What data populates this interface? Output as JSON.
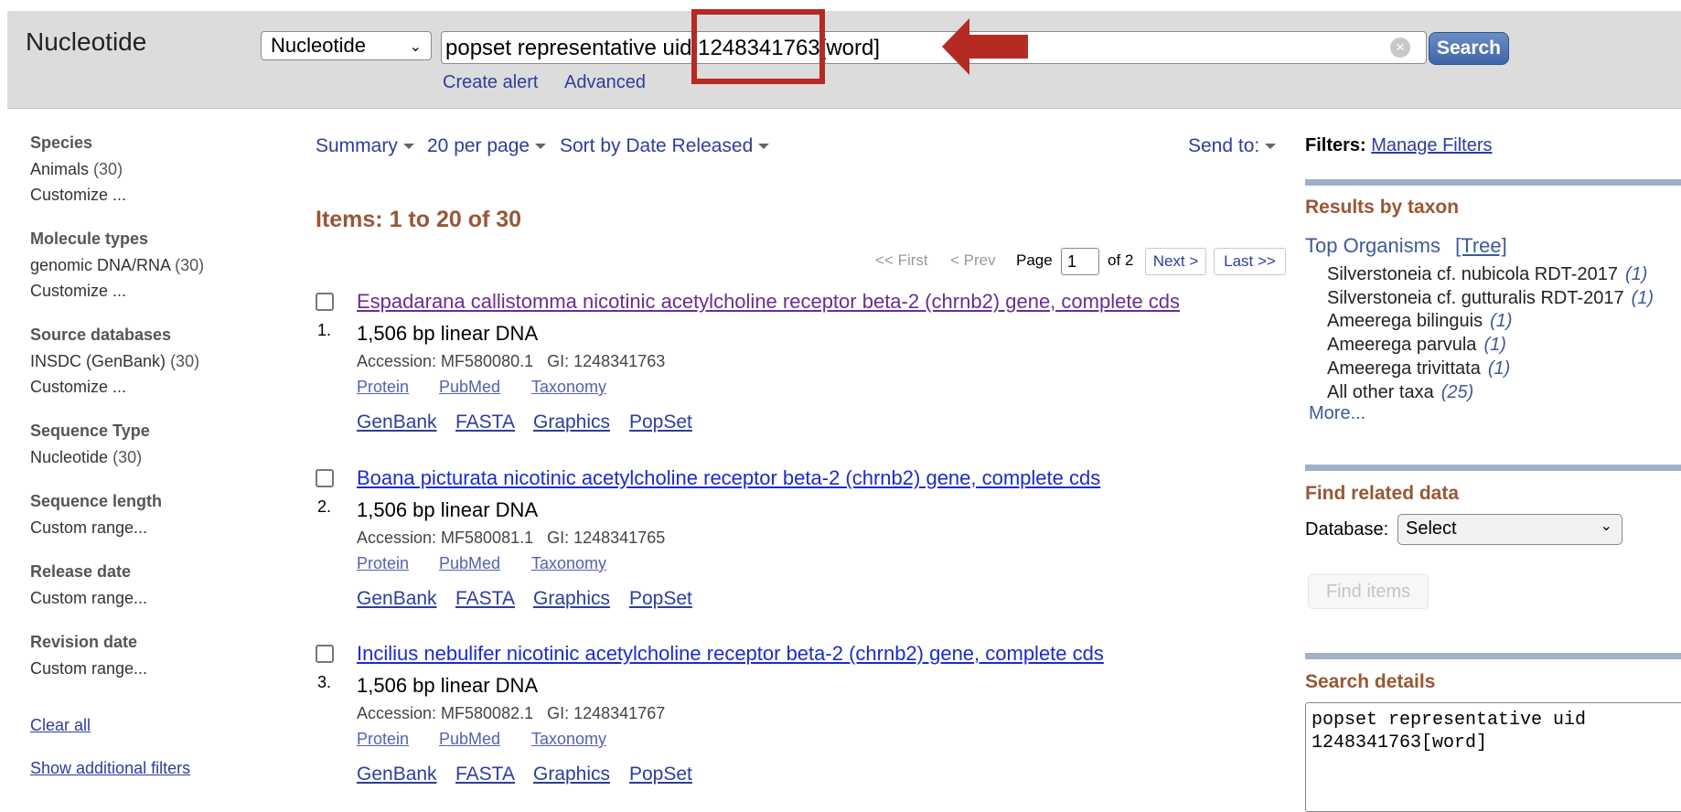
{
  "header": {
    "db_title": "Nucleotide",
    "db_select": "Nucleotide",
    "search_value": "popset representative uid 1248341763[word]",
    "search_button": "Search",
    "create_alert": "Create alert",
    "advanced": "Advanced"
  },
  "sidebar": {
    "species_h": "Species",
    "species_item": "Animals",
    "species_count": "(30)",
    "species_customize": "Customize ...",
    "mol_h": "Molecule types",
    "mol_item": "genomic DNA/RNA",
    "mol_count": "(30)",
    "mol_customize": "Customize ...",
    "src_h": "Source databases",
    "src_item": "INSDC (GenBank)",
    "src_count": "(30)",
    "src_customize": "Customize ...",
    "seqtype_h": "Sequence Type",
    "seqtype_item": "Nucleotide",
    "seqtype_count": "(30)",
    "seqlen_h": "Sequence length",
    "seqlen_item": "Custom range...",
    "rel_h": "Release date",
    "rel_item": "Custom range...",
    "rev_h": "Revision date",
    "rev_item": "Custom range...",
    "clear_all": "Clear all",
    "show_filters": "Show additional filters"
  },
  "toolbar": {
    "summary": "Summary",
    "per_page": "20 per page",
    "sort": "Sort by Date Released",
    "send_to": "Send to:"
  },
  "results": {
    "heading": "Items: 1 to 20 of 30",
    "pager": {
      "first": "<< First",
      "prev": "< Prev",
      "page_label": "Page",
      "page_value": "1",
      "of": "of 2",
      "next": "Next >",
      "last": "Last >>"
    },
    "items": [
      {
        "num": "1.",
        "title": "Espadarana callistomma nicotinic acetylcholine receptor beta-2 (chrnb2) gene, complete cds",
        "desc": "1,506 bp linear DNA",
        "acc": "Accession: MF580080.1   GI: 1248341763",
        "links": [
          "Protein",
          "PubMed",
          "Taxonomy"
        ],
        "main_links": [
          "GenBank",
          "FASTA",
          "Graphics",
          "PopSet"
        ],
        "visited": true
      },
      {
        "num": "2.",
        "title": "Boana picturata nicotinic acetylcholine receptor beta-2 (chrnb2) gene, complete cds",
        "desc": "1,506 bp linear DNA",
        "acc": "Accession: MF580081.1   GI: 1248341765",
        "links": [
          "Protein",
          "PubMed",
          "Taxonomy"
        ],
        "main_links": [
          "GenBank",
          "FASTA",
          "Graphics",
          "PopSet"
        ],
        "visited": false
      },
      {
        "num": "3.",
        "title": "Incilius nebulifer nicotinic acetylcholine receptor beta-2 (chrnb2) gene, complete cds",
        "desc": "1,506 bp linear DNA",
        "acc": "Accession: MF580082.1   GI: 1248341767",
        "links": [
          "Protein",
          "PubMed",
          "Taxonomy"
        ],
        "main_links": [
          "GenBank",
          "FASTA",
          "Graphics",
          "PopSet"
        ],
        "visited": false
      }
    ]
  },
  "right": {
    "filters_label": "Filters:",
    "manage_filters": "Manage Filters",
    "taxon_h": "Results by taxon",
    "top_organisms": "Top Organisms",
    "tree": "[Tree]",
    "taxa": [
      {
        "name": "Silverstoneia cf. nubicola RDT-2017",
        "count": "(1)"
      },
      {
        "name": "Silverstoneia cf. gutturalis RDT-2017",
        "count": "(1)"
      },
      {
        "name": "Ameerega bilinguis",
        "count": "(1)"
      },
      {
        "name": "Ameerega parvula",
        "count": "(1)"
      },
      {
        "name": "Ameerega trivittata",
        "count": "(1)"
      },
      {
        "name": "All other taxa",
        "count": "(25)"
      }
    ],
    "more": "More...",
    "related_h": "Find related data",
    "database_label": "Database:",
    "database_value": "Select",
    "find_items": "Find items",
    "details_h": "Search details",
    "details_text": "popset representative uid\n1248341763[word]"
  },
  "colors": {
    "accent_brown": "#985735",
    "link_blue": "#2e3d9c",
    "visited_purple": "#6b2c91",
    "annotation_red": "#b52a22",
    "search_button": "#3f66a8"
  },
  "icons": [
    "chevron-down-icon",
    "clear-icon",
    "arrow-annotation-icon",
    "caret-icon",
    "checkbox-icon"
  ]
}
